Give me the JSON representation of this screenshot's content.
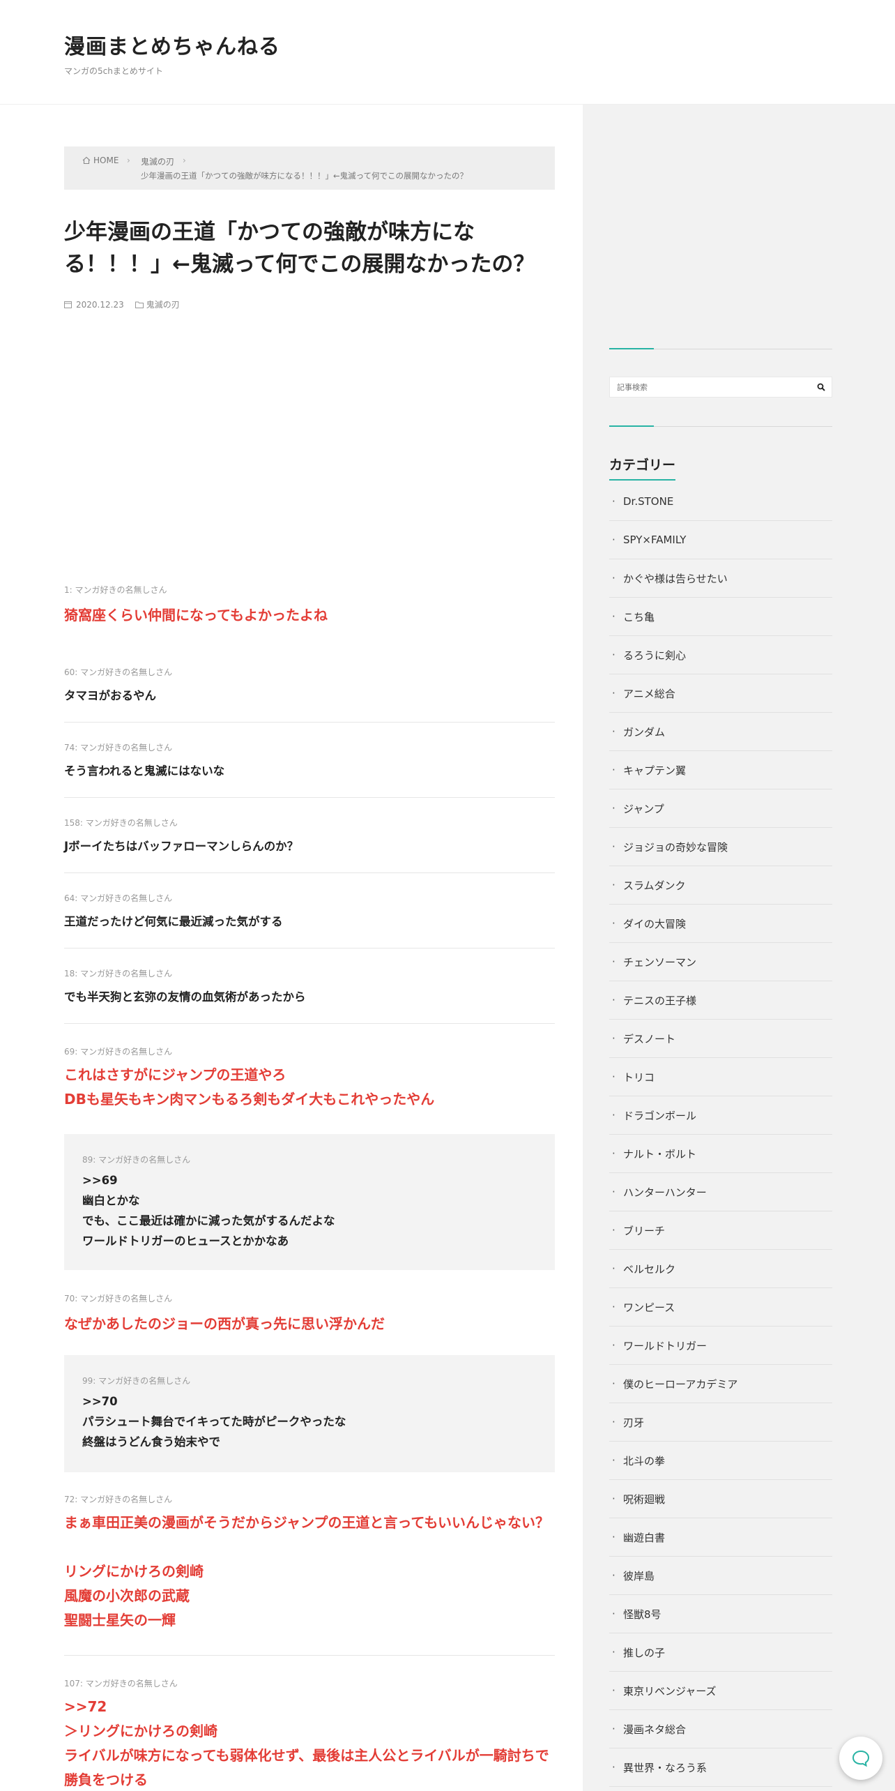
{
  "site": {
    "title": "漫画まとめちゃんねる",
    "tagline": "マンガの5chまとめサイト"
  },
  "breadcrumb": {
    "home": "HOME",
    "category": "鬼滅の刃",
    "current": "少年漫画の王道「かつての強敵が味方になる！！！」←鬼滅って何でこの展開なかったの？"
  },
  "post": {
    "title_line1": "少年漫画の王道「かつての強敵が味方にな",
    "title_line2": "る！！！」←鬼滅って何でこの展開なかったの？",
    "date": "2020.12.23",
    "category": "鬼滅の刃"
  },
  "comments": [
    {
      "name": "1: マンガ好きの名無しさん",
      "lines": [
        "猗窩座くらい仲間になってもよかったよね"
      ]
    },
    {
      "name": "60: マンガ好きの名無しさん",
      "lines": [
        "タマヨがおるやん"
      ]
    },
    {
      "name": "74: マンガ好きの名無しさん",
      "lines": [
        "そう言われると鬼滅にはないな"
      ]
    },
    {
      "name": "158: マンガ好きの名無しさん",
      "lines": [
        "Jボーイたちはバッファローマンしらんのか？"
      ]
    },
    {
      "name": "64: マンガ好きの名無しさん",
      "lines": [
        "王道だったけど何気に最近減った気がする"
      ]
    },
    {
      "name": "18: マンガ好きの名無しさん",
      "lines": [
        "でも半天狗と玄弥の友情の血気術があったから"
      ]
    },
    {
      "name": "69: マンガ好きの名無しさん",
      "lines": [
        "これはさすがにジャンプの王道やろ",
        "DBも星矢もキン肉マンもるろ剣もダイ大もこれやったやん"
      ]
    },
    {
      "name": "89: マンガ好きの名無しさん",
      "lines": [
        ">>69",
        "幽白とかな",
        "でも、ここ最近は確かに減った気がするんだよな",
        "ワールドトリガーのヒュースとかかなあ"
      ]
    },
    {
      "name": "70: マンガ好きの名無しさん",
      "lines": [
        "なぜかあしたのジョーの西が真っ先に思い浮かんだ"
      ]
    },
    {
      "name": "99: マンガ好きの名無しさん",
      "lines": [
        ">>70",
        "パラシュート舞台でイキってた時がピークやったな",
        "終盤はうどん食う始末やで"
      ]
    },
    {
      "name": "72: マンガ好きの名無しさん",
      "lines": [
        "まぁ車田正美の漫画がそうだからジャンプの王道と言ってもいいんじゃない？",
        "",
        "リングにかけろの剣崎",
        "風魔の小次郎の武蔵",
        "聖闘士星矢の一輝"
      ]
    },
    {
      "name": "107: マンガ好きの名無しさん",
      "lines": [
        ">>72",
        "＞リングにかけろの剣崎",
        "ライバルが味方になっても弱体化せず、最後は主人公とライバルが一騎討ちで",
        "勝負をつける"
      ]
    }
  ],
  "sidebar": {
    "search_placeholder": "記事検索",
    "category_heading": "カテゴリー",
    "categories": [
      "Dr.STONE",
      "SPY×FAMILY",
      "かぐや様は告らせたい",
      "こち亀",
      "るろうに剣心",
      "アニメ総合",
      "ガンダム",
      "キャプテン翼",
      "ジャンプ",
      "ジョジョの奇妙な冒険",
      "スラムダンク",
      "ダイの大冒険",
      "チェンソーマン",
      "テニスの王子様",
      "デスノート",
      "トリコ",
      "ドラゴンボール",
      "ナルト・ボルト",
      "ハンターハンター",
      "ブリーチ",
      "ベルセルク",
      "ワンピース",
      "ワールドトリガー",
      "僕のヒーローアカデミア",
      "刃牙",
      "北斗の拳",
      "呪術廻戦",
      "幽遊白書",
      "彼岸島",
      "怪獣8号",
      "推しの子",
      "東京リベンジャーズ",
      "漫画ネタ総合",
      "異世界・なろう系"
    ]
  },
  "colors": {
    "accent": "#28b3a4",
    "highlight_text": "#e33d36",
    "sidebar_bg": "#f2f2f2"
  }
}
